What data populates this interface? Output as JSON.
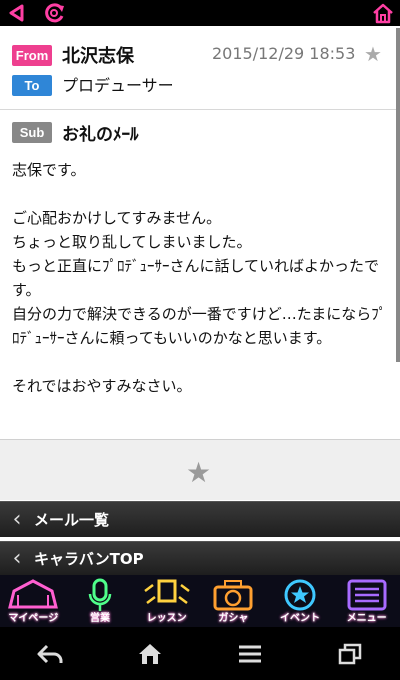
{
  "topbar": {
    "back_icon": "back-triangle-icon",
    "reload_icon": "reload-icon",
    "home_icon": "home-icon",
    "accent": "#ff3fa4"
  },
  "mail": {
    "from_label": "From",
    "from_name": "北沢志保",
    "datetime": "2015/12/29 18:53",
    "to_label": "To",
    "to_name": "プロデューサー",
    "subject_label": "Sub",
    "subject": "お礼のﾒｰﾙ",
    "body": "志保です。\n\nご心配おかけしてすみません。\nちょっと取り乱してしまいました。\nもっと正直にﾌﾟﾛﾃﾞｭｰｻｰさんに話していればよかったです。\n自分の力で解決できるのが一番ですけど…たまにならﾌﾟﾛﾃﾞｭｰｻｰさんに頼ってもいいのかなと思います。\n\nそれではおやすみなさい。"
  },
  "star_glyph": "★",
  "nav": [
    {
      "label": "メール一覧",
      "chevron": "‹"
    },
    {
      "label": "キャラバンTOP",
      "chevron": "‹"
    }
  ],
  "menu": [
    {
      "label": "マイページ",
      "icon": "mypage-icon",
      "color": "#ff5fd0"
    },
    {
      "label": "営業",
      "icon": "microphone-icon",
      "color": "#4fff8a"
    },
    {
      "label": "レッスン",
      "icon": "lesson-icon",
      "color": "#ffd23f"
    },
    {
      "label": "ガシャ",
      "icon": "camera-icon",
      "color": "#ffa030"
    },
    {
      "label": "イベント",
      "icon": "event-badge-icon",
      "color": "#3fc8ff"
    },
    {
      "label": "メニュー",
      "icon": "menu-list-icon",
      "color": "#a86bff"
    }
  ],
  "system": [
    "back-arrow-icon",
    "home-icon",
    "menu-lines-icon",
    "recent-apps-icon"
  ]
}
